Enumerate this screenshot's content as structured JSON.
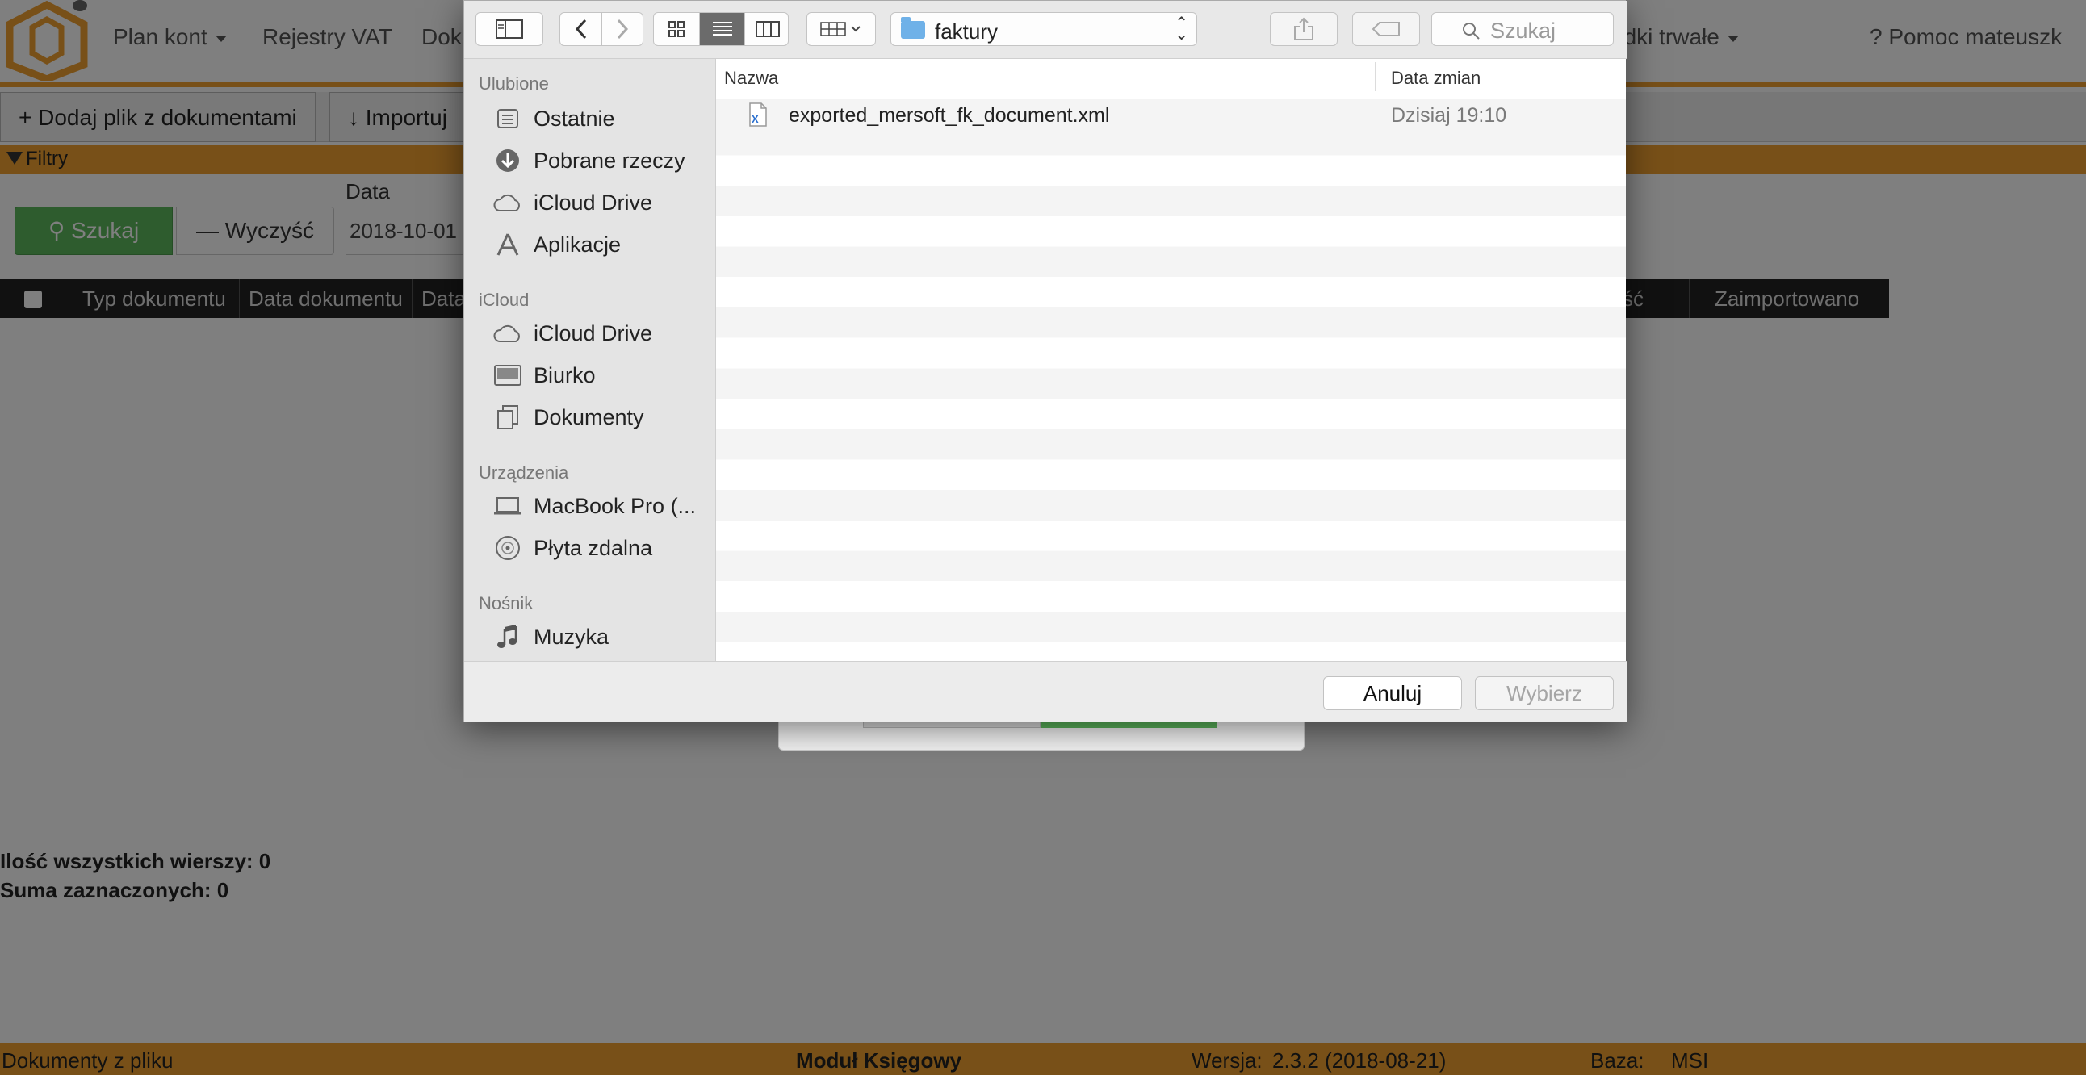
{
  "app": {
    "nav": {
      "items": [
        "Plan kont",
        "Rejestry VAT",
        "Dok",
        "odki trwałe"
      ],
      "help": "? Pomoc mateuszk"
    },
    "toolbar": {
      "add_file": "Dodaj plik z dokumentami",
      "import": "Importuj"
    },
    "filters": {
      "title": "Filtry",
      "date_label": "Data",
      "search_button": "Szukaj",
      "clear_button": "Wyczyść",
      "date_value": "2018-10-01"
    },
    "table": {
      "columns": [
        "Typ dokumentu",
        "Data dokumentu",
        "Data",
        "ść",
        "Zaimportowano"
      ]
    },
    "summary": {
      "rows_total": "Ilość wszystkich wierszy: 0",
      "selected_sum": "Suma zaznaczonych: 0"
    },
    "footer": {
      "left": "Dokumenty z pliku",
      "center": "Moduł Księgowy",
      "version_label": "Wersja:",
      "version_value": "2.3.2 (2018-08-21)",
      "db_label": "Baza:",
      "db_value": "MSI"
    },
    "accent_color": "#f0a030"
  },
  "dialog": {
    "folder": "faktury",
    "search_placeholder": "Szukaj",
    "sidebar": {
      "sections": [
        {
          "title": "Ulubione",
          "items": [
            "Ostatnie",
            "Pobrane rzeczy",
            "iCloud Drive",
            "Aplikacje"
          ]
        },
        {
          "title": "iCloud",
          "items": [
            "iCloud Drive",
            "Biurko",
            "Dokumenty"
          ]
        },
        {
          "title": "Urządzenia",
          "items": [
            "MacBook Pro (...",
            "Płyta zdalna"
          ]
        },
        {
          "title": "Nośnik",
          "items": [
            "Muzyka"
          ]
        }
      ]
    },
    "columns": {
      "name": "Nazwa",
      "date": "Data zmian"
    },
    "files": [
      {
        "name": "exported_mersoft_fk_document.xml",
        "date": "Dzisiaj 19:10",
        "icon": "xml-file-icon"
      }
    ],
    "buttons": {
      "cancel": "Anuluj",
      "choose": "Wybierz"
    }
  }
}
